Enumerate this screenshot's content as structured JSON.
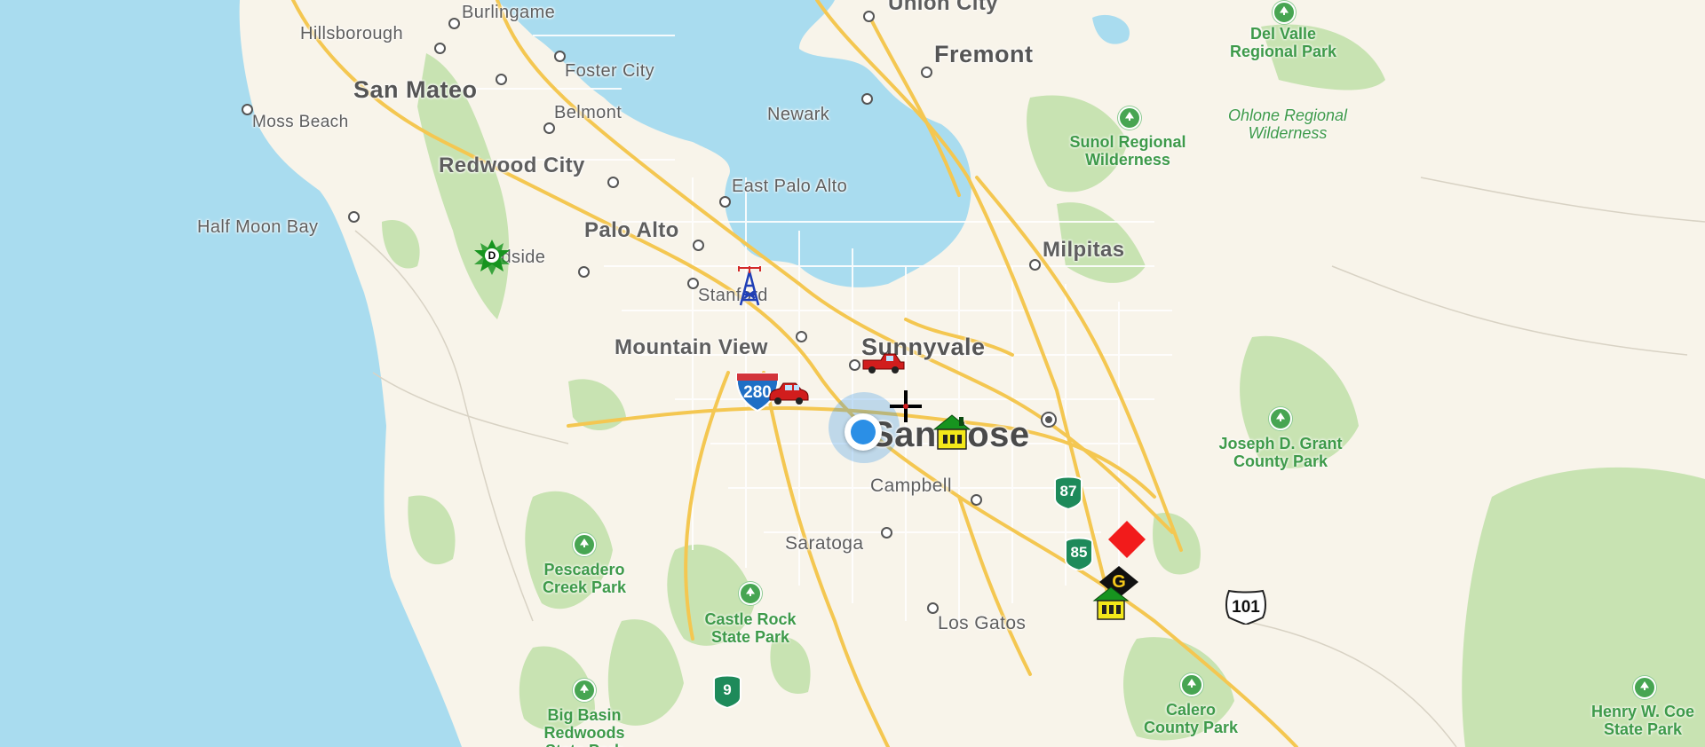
{
  "map": {
    "colors": {
      "water": "#a9dcef",
      "land": "#f8f4ea",
      "park": "#c8e3b2",
      "highway": "#f4c751",
      "road": "#ffffff",
      "user_location": "#2b8fe6"
    },
    "cities": {
      "burlingame": "Burlingame",
      "union_city": "Union City",
      "hillsborough": "Hillsborough",
      "fremont": "Fremont",
      "foster_city": "Foster City",
      "san_mateo": "San Mateo",
      "moss_beach": "Moss Beach",
      "belmont": "Belmont",
      "newark": "Newark",
      "redwood_city": "Redwood City",
      "east_palo_alto": "East Palo Alto",
      "half_moon_bay": "Half Moon Bay",
      "palo_alto": "Palo Alto",
      "milpitas": "Milpitas",
      "woodside": "odside",
      "stanford": "Stanford",
      "mountain_view": "Mountain View",
      "sunnyvale": "Sunnyvale",
      "san_jose": "San Jose",
      "campbell": "Campbell",
      "saratoga": "Saratoga",
      "los_gatos": "Los Gatos"
    },
    "parks": {
      "del_valle": "Del Valle\nRegional Park",
      "ohlone": "Ohlone Regional\nWilderness",
      "sunol": "Sunol Regional\nWilderness",
      "joseph_grant": "Joseph D. Grant\nCounty Park",
      "pescadero": "Pescadero\nCreek Park",
      "castle_rock": "Castle Rock\nState Park",
      "big_basin": "Big Basin\nRedwoods\nState Park",
      "calero": "Calero\nCounty Park",
      "henry_coe": "Henry W. Coe\nState Park"
    },
    "shields": {
      "i280": "280",
      "sr87": "87",
      "sr85": "85",
      "sr9": "9",
      "us101": "101"
    },
    "markers": {
      "star_letter": "D",
      "diamond_letter": "G"
    }
  }
}
